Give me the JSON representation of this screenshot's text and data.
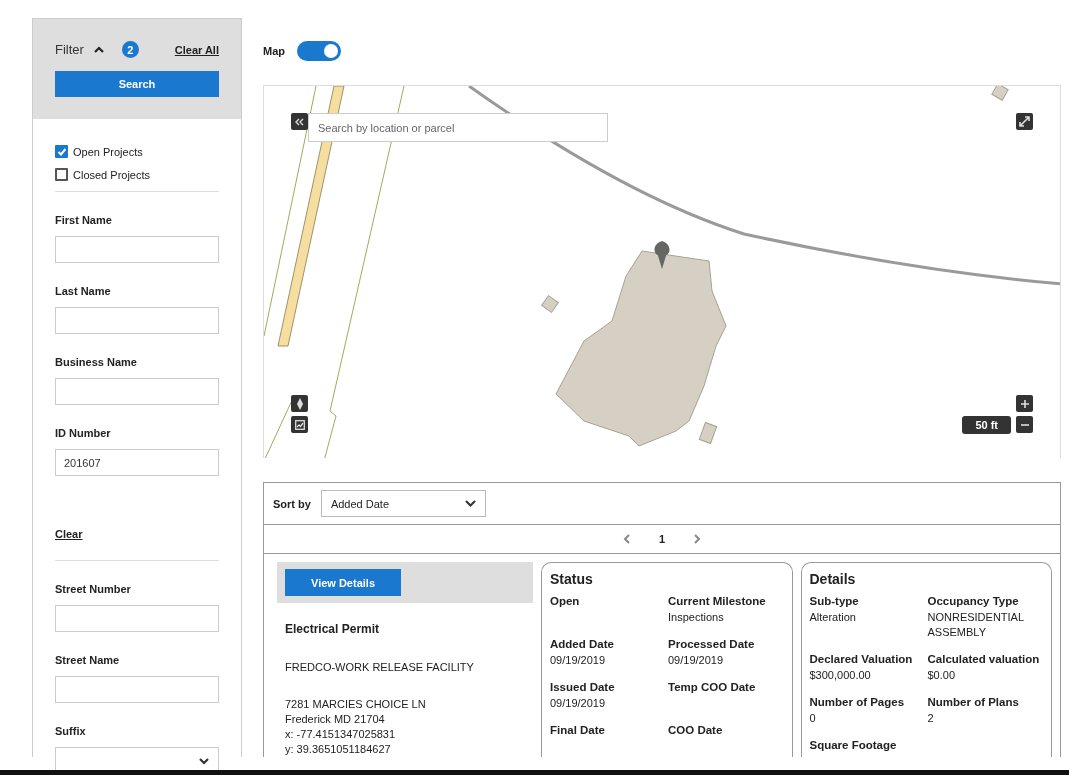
{
  "filter": {
    "title": "Filter",
    "expanded": true,
    "badge": "2",
    "clear_all": "Clear All",
    "search_button": "Search",
    "checkboxes": [
      {
        "label": "Open Projects",
        "checked": true
      },
      {
        "label": "Closed Projects",
        "checked": false
      }
    ],
    "fields": [
      {
        "label": "First Name",
        "kind": "text"
      },
      {
        "label": "Last Name",
        "kind": "text"
      },
      {
        "label": "Business Name",
        "kind": "text"
      },
      {
        "label": "ID Number",
        "kind": "text",
        "value": "201607"
      }
    ],
    "clear": "Clear",
    "address_fields": [
      {
        "label": "Street Number",
        "kind": "text"
      },
      {
        "label": "Street Name",
        "kind": "text"
      },
      {
        "label": "Suffix",
        "kind": "select"
      }
    ]
  },
  "map_toggle": {
    "label": "Map",
    "on": true
  },
  "map": {
    "search": {
      "placeholder": "Search by location or parcel"
    },
    "scale": "50 ft"
  },
  "results": {
    "sort": {
      "label": "Sort by",
      "value": "Added Date"
    },
    "pager": {
      "page": "1"
    },
    "card": {
      "button": "View Details",
      "type": "Electrical Permit",
      "name": "FREDCO-WORK RELEASE FACILITY",
      "address_lines": [
        "7281 MARCIES CHOICE LN",
        "Frederick MD 21704",
        "x: -77.4151347025831",
        "y: 39.3651051184627"
      ]
    },
    "status": {
      "title": "Status",
      "items": [
        {
          "label": "Open"
        },
        {
          "label": "Current Milestone",
          "value": "Inspections"
        },
        {
          "label": "Added Date",
          "value": "09/19/2019"
        },
        {
          "label": "Processed Date",
          "value": "09/19/2019"
        },
        {
          "label": "Issued Date",
          "value": "09/19/2019"
        },
        {
          "label": "Temp COO Date"
        },
        {
          "label": "Final Date"
        },
        {
          "label": "COO Date"
        }
      ]
    },
    "details": {
      "title": "Details",
      "items": [
        {
          "label": "Sub-type",
          "value": "Alteration"
        },
        {
          "label": "Occupancy Type",
          "value": "NONRESIDENTIAL ASSEMBLY"
        },
        {
          "label": "Declared Valuation",
          "value": "$300,000.00"
        },
        {
          "label": "Calculated valuation",
          "value": "$0.00"
        },
        {
          "label": "Number of Pages",
          "value": "0"
        },
        {
          "label": "Number of Plans",
          "value": "2"
        },
        {
          "label": "Square Footage"
        }
      ]
    }
  }
}
